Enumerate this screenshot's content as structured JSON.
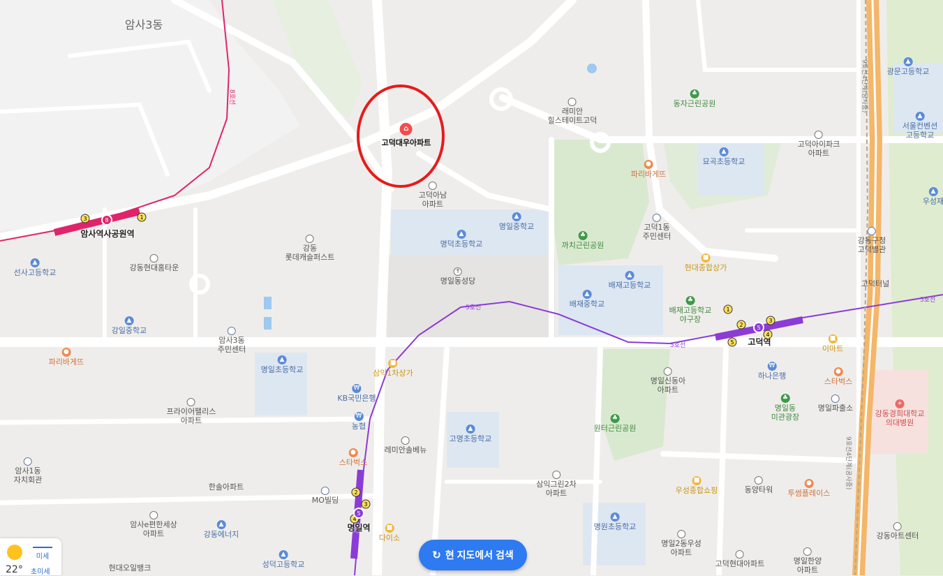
{
  "district_name": "암사3동",
  "selected_place": "고덕대우아파트",
  "stations": [
    {
      "name": "암사역사공원역",
      "lines": [
        "3",
        "8",
        "1"
      ]
    },
    {
      "name": "고덕역",
      "lines": [
        "1",
        "2",
        "3",
        "4",
        "5"
      ]
    },
    {
      "name": "명일역",
      "lines": [
        "2",
        "3",
        "4",
        "5"
      ]
    }
  ],
  "line_labels": {
    "line8": "8호선",
    "line5_a": "5호선",
    "line5_b": "5호선",
    "line5_c": "5호선",
    "line9_a": "9호선4단계(공사중)",
    "line9_b": "9호선4단계(공사중)"
  },
  "pois": [
    {
      "name": "래미안\n힐스테이트고덕",
      "type": "apt"
    },
    {
      "name": "동자근린공원",
      "type": "park"
    },
    {
      "name": "광문고등학교",
      "type": "school"
    },
    {
      "name": "서울컨벤션\n고등학교",
      "type": "school"
    },
    {
      "name": "고덕아이파크\n아파트",
      "type": "apt"
    },
    {
      "name": "묘곡초등학교",
      "type": "school"
    },
    {
      "name": "파리바게뜨",
      "type": "food"
    },
    {
      "name": "고덕아남\n아파트",
      "type": "apt"
    },
    {
      "name": "명일중학교",
      "type": "school"
    },
    {
      "name": "명덕초등학교",
      "type": "school"
    },
    {
      "name": "까치근린공원",
      "type": "park"
    },
    {
      "name": "고덕1동\n주민센터",
      "type": "gov"
    },
    {
      "name": "우성재",
      "type": "school"
    },
    {
      "name": "강동구청\n고덕별관",
      "type": "gov"
    },
    {
      "name": "현대종합상가",
      "type": "shop"
    },
    {
      "name": "고덕터널",
      "type": "none"
    },
    {
      "name": "명일동성당",
      "type": "church"
    },
    {
      "name": "배재고등학교",
      "type": "school"
    },
    {
      "name": "배재중학교",
      "type": "school"
    },
    {
      "name": "배재고등학교\n야구장",
      "type": "park"
    },
    {
      "name": "강동\n롯데캐슬퍼스트",
      "type": "apt"
    },
    {
      "name": "선사고등학교",
      "type": "school"
    },
    {
      "name": "강동현대홈타운",
      "type": "apt"
    },
    {
      "name": "강일중학교",
      "type": "school"
    },
    {
      "name": "암사3동\n주민센터",
      "type": "gov"
    },
    {
      "name": "파리바게뜨",
      "type": "food"
    },
    {
      "name": "명일초등학교",
      "type": "school"
    },
    {
      "name": "삼익1차상가",
      "type": "shop"
    },
    {
      "name": "이마트",
      "type": "shop"
    },
    {
      "name": "명일신동아\n아파트",
      "type": "apt"
    },
    {
      "name": "하나은행",
      "type": "bank"
    },
    {
      "name": "스타벅스",
      "type": "food"
    },
    {
      "name": "강동경희대학교\n의대병원",
      "type": "hosp"
    },
    {
      "name": "KB국민은행",
      "type": "bank"
    },
    {
      "name": "농협",
      "type": "bank"
    },
    {
      "name": "프라이어팰리스\n아파트",
      "type": "apt"
    },
    {
      "name": "레미안솔베뉴",
      "type": "apt"
    },
    {
      "name": "고명초등학교",
      "type": "school"
    },
    {
      "name": "원터근린공원",
      "type": "park"
    },
    {
      "name": "명일동\n미관광장",
      "type": "park"
    },
    {
      "name": "명일파출소",
      "type": "gov"
    },
    {
      "name": "암사1동\n자치회관",
      "type": "gov"
    },
    {
      "name": "스타벅스",
      "type": "food"
    },
    {
      "name": "한솔아파트",
      "type": "apt"
    },
    {
      "name": "삼익그린2차\n아파트",
      "type": "apt"
    },
    {
      "name": "MO빌딩",
      "type": "gov"
    },
    {
      "name": "우성종합쇼핑",
      "type": "shop"
    },
    {
      "name": "동양타워",
      "type": "apt"
    },
    {
      "name": "투썸플레이스",
      "type": "food"
    },
    {
      "name": "암사e편한세상\n아파트",
      "type": "apt"
    },
    {
      "name": "강동에너지",
      "type": "gov"
    },
    {
      "name": "다이소",
      "type": "shop"
    },
    {
      "name": "명원초등학교",
      "type": "school"
    },
    {
      "name": "명일2동우성\n아파트",
      "type": "apt"
    },
    {
      "name": "강동아트센터",
      "type": "apt"
    },
    {
      "name": "현대오일뱅크",
      "type": "gov"
    },
    {
      "name": "성덕고등학교",
      "type": "school"
    },
    {
      "name": "고덕현대아파트",
      "type": "apt"
    },
    {
      "name": "명일한양\n아파트",
      "type": "apt"
    }
  ],
  "weather": {
    "temperature": "22°",
    "dust_label": "미세",
    "fine_dust_label": "초미세"
  },
  "search_button": {
    "label": "현 지도에서 검색"
  },
  "colors": {
    "line5": "#8b3bd6",
    "line8": "#e0246b",
    "search_button": "#2d7af1",
    "highlight_circle": "#e51c1c"
  }
}
